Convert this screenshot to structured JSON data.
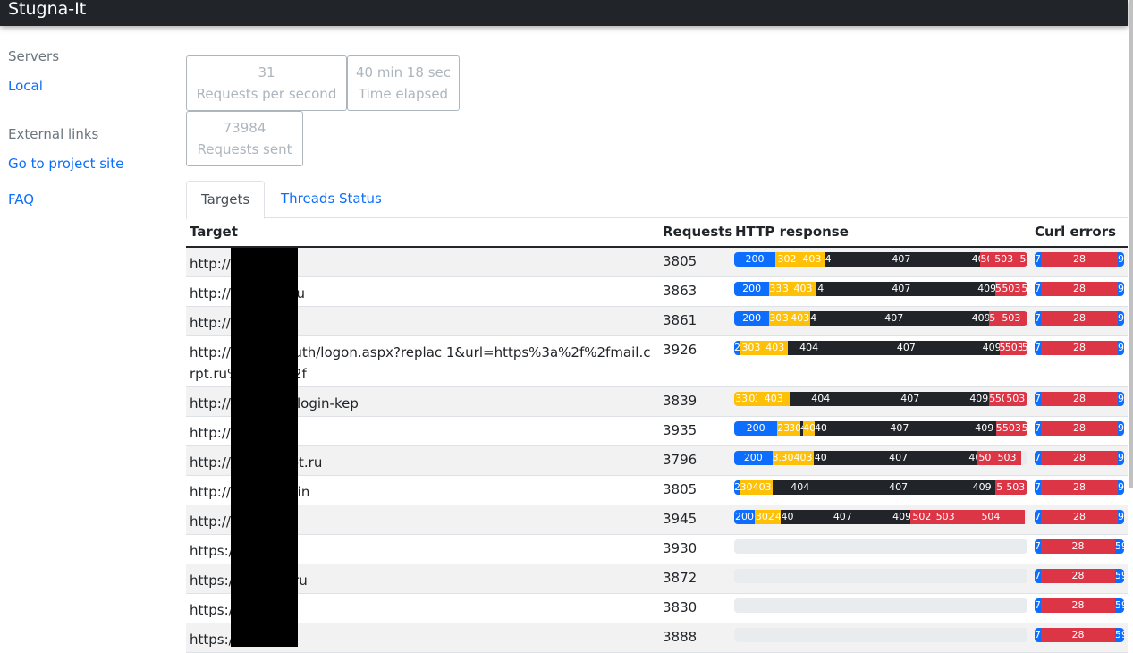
{
  "navbar": {
    "brand": "Stugna-It"
  },
  "sidebar": {
    "servers_heading": "Servers",
    "local_link": "Local",
    "external_heading": "External links",
    "project_link": "Go to project site",
    "faq_link": "FAQ"
  },
  "stats": {
    "rps_value": "31",
    "rps_label": "Requests per second",
    "elapsed_value": "40 min 18 sec",
    "elapsed_label": "Time elapsed",
    "sent_value": "73984",
    "sent_label": "Requests sent"
  },
  "tabs": {
    "targets": "Targets",
    "threads": "Threads Status"
  },
  "table": {
    "headers": {
      "target": "Target",
      "requests": "Requests",
      "http": "HTTP response",
      "curl": "Curl errors"
    },
    "rows": [
      {
        "target": "http://          crpt.ru",
        "requests": "3805"
      },
      {
        "target": "http://          dlp.crpt.ru",
        "requests": "3863"
      },
      {
        "target": "http://          .ru",
        "requests": "3861"
      },
      {
        "target": "http://          ru/owa/auth/logon.aspx?replac          1&url=https%3a%2f%2fmail.crpt.ru%2fowa%2f",
        "requests": "3926"
      },
      {
        "target": "http://          a.crpt.ru/login-kep",
        "requests": "3839"
      },
      {
        "target": "http://          ru/",
        "requests": "3935"
      },
      {
        "target": "http://          .mdlp.crpt.ru",
        "requests": "3796"
      },
      {
        "target": "http://          rpt.ru/login",
        "requests": "3805"
      },
      {
        "target": "http://          ru",
        "requests": "3945"
      },
      {
        "target": "https:/          .crpt.ru",
        "requests": "3930"
      },
      {
        "target": "https:/          dlp.crpt.ru",
        "requests": "3872"
      },
      {
        "target": "https:/          t.ru",
        "requests": "3830"
      },
      {
        "target": "https:/          u",
        "requests": "3888"
      }
    ]
  },
  "colors": {
    "primary": "#0d6efd",
    "warning": "#ffc107",
    "dark": "#212529",
    "danger": "#dc3545",
    "empty": "#e9ecef"
  }
}
